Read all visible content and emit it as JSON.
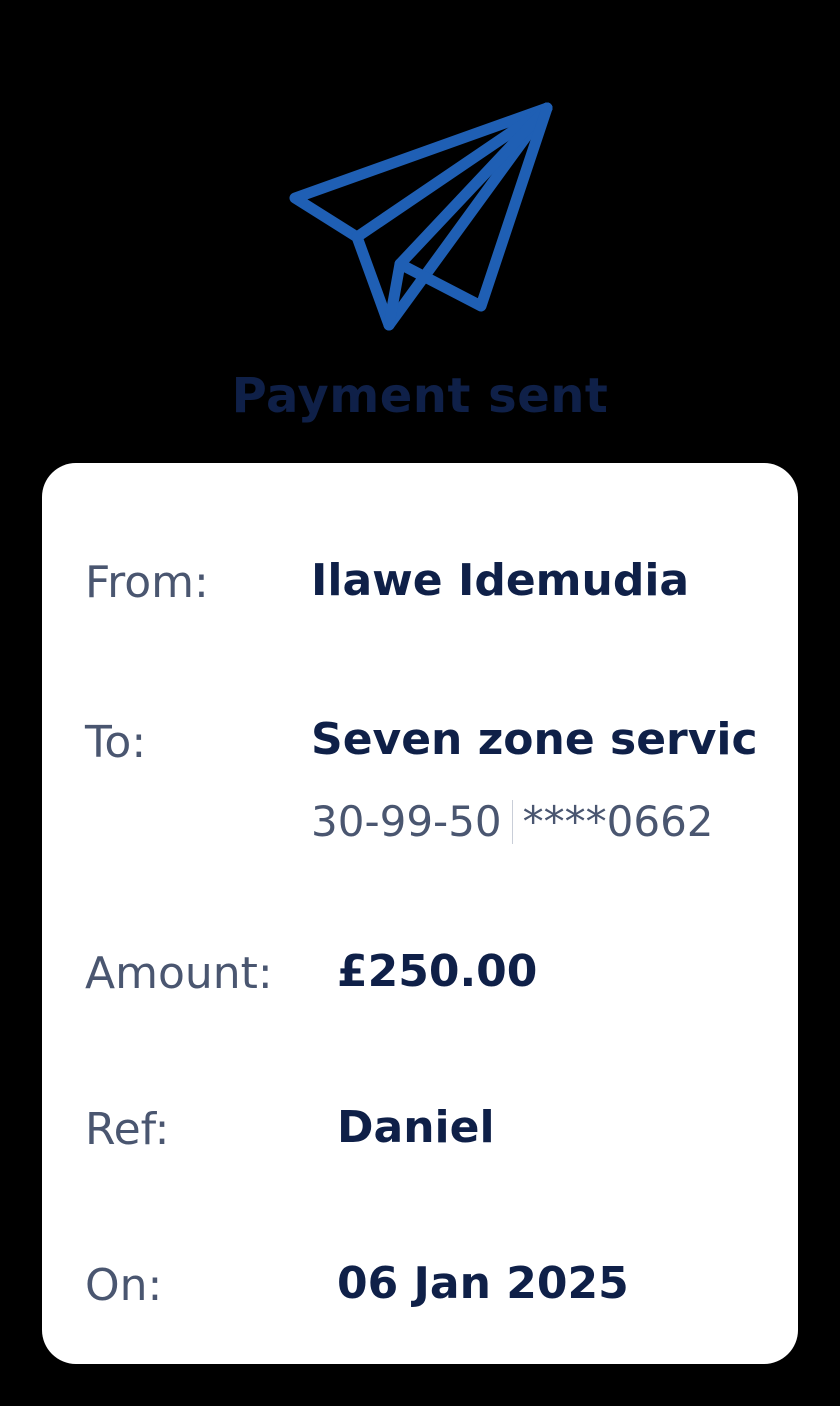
{
  "header": {
    "icon": "paper-plane-icon",
    "icon_color": "#1f5fb4",
    "title": "Payment sent",
    "title_color": "#0f2048"
  },
  "details": {
    "from_label": "From:",
    "from_value": "Ilawe Idemudia",
    "to_label": "To:",
    "to_value": "Seven zone service L",
    "sort_code": "30-99-50",
    "account_masked": "****0662",
    "amount_label": "Amount:",
    "amount_value": "£250.00",
    "ref_label": "Ref:",
    "ref_value": "Daniel",
    "on_label": "On:",
    "on_value": "06 Jan 2025"
  }
}
